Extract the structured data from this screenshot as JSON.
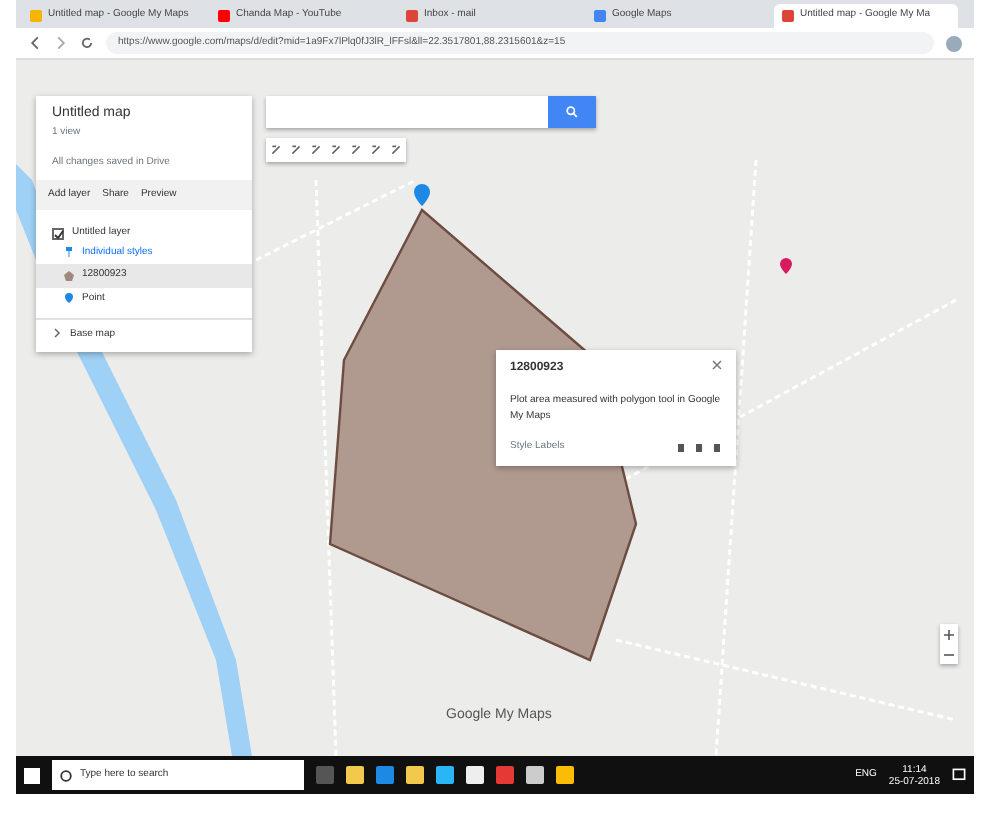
{
  "browser": {
    "tabs": [
      {
        "title": "Untitled map - Google My Maps",
        "selected": false,
        "color": "#f4b400"
      },
      {
        "title": "Chanda Map - YouTube",
        "selected": false,
        "color": "#ff0000"
      },
      {
        "title": "Inbox - mail",
        "selected": false,
        "color": "#db4437"
      },
      {
        "title": "Google Maps",
        "selected": false,
        "color": "#4285f4"
      },
      {
        "title": "Untitled map - Google My Ma",
        "selected": true,
        "color": "#db4437"
      }
    ],
    "url": "https://www.google.com/maps/d/edit?mid=1a9Fx7lPlq0fJ3lR_lFFsl&ll=22.3517801,88.2315601&z=15"
  },
  "map_panel": {
    "title": "Untitled map",
    "subtitle": "1 view",
    "status": "All changes saved in Drive",
    "actions": [
      "Add layer",
      "Share",
      "Preview"
    ],
    "layer": {
      "name": "Untitled layer",
      "checked": true,
      "style": "Individual styles",
      "items": [
        {
          "kind": "polygon",
          "label": "12800923",
          "selected": true
        },
        {
          "kind": "pin",
          "label": "Point",
          "selected": false
        }
      ]
    },
    "base_map": "Base map"
  },
  "popup": {
    "title": "12800923",
    "description": "Plot area measured with polygon tool in Google My Maps",
    "footer": "Style  Labels"
  },
  "attribution": "Google My Maps",
  "taskbar": {
    "search_placeholder": "Type here to search",
    "language": "ENG",
    "time": "11:14",
    "date": "25-07-2018"
  }
}
